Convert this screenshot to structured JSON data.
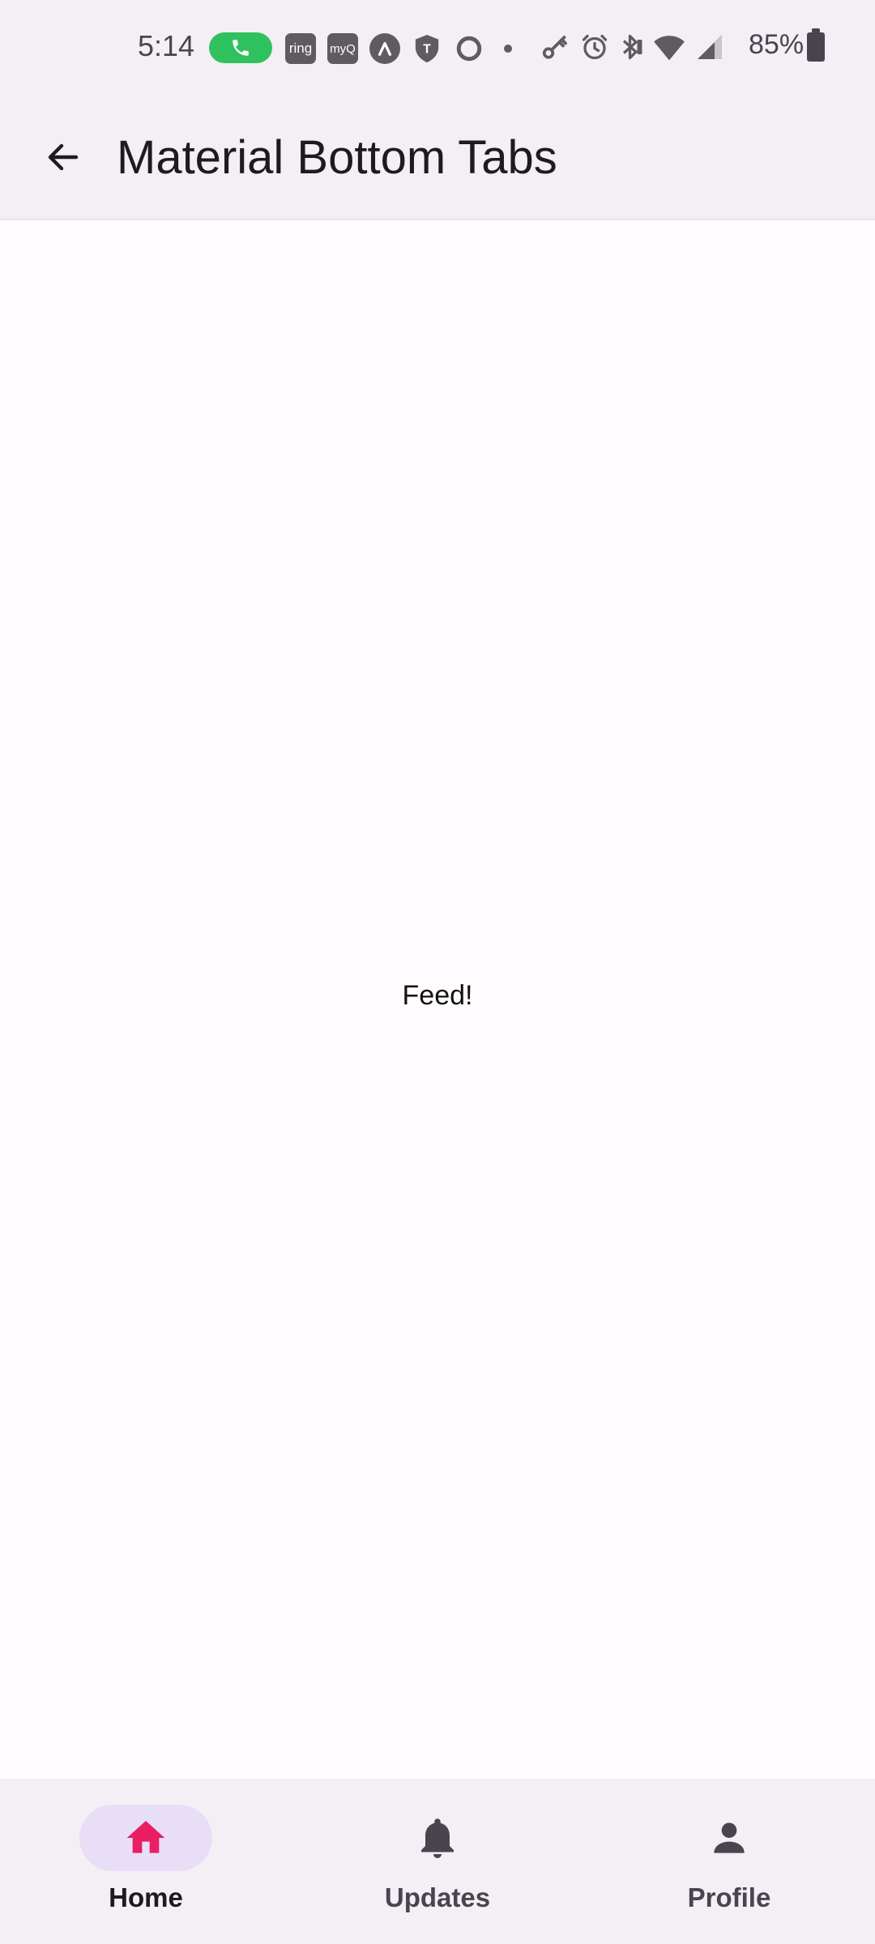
{
  "status_bar": {
    "time": "5:14",
    "battery": "85%",
    "notification_icons": [
      "call-active-icon",
      "ring-icon",
      "myq-icon",
      "arc-icon",
      "tmobile-shield-icon",
      "circle-app-icon",
      "dot-icon"
    ],
    "system_icons": [
      "vpn-key-icon",
      "alarm-icon",
      "bluetooth-icon",
      "wifi-icon",
      "cellular-signal-icon",
      "battery-icon"
    ],
    "ring_label": "ring",
    "myq_label": "myQ",
    "call_color": "#2fc15d"
  },
  "app_bar": {
    "title": "Material Bottom Tabs",
    "back_icon": "arrow-back-icon"
  },
  "content": {
    "text": "Feed!"
  },
  "bottom_nav": {
    "active_indicator_color": "#e8def8",
    "active_icon_color": "#e91e63",
    "items": [
      {
        "label": "Home",
        "icon": "home-icon",
        "active": true
      },
      {
        "label": "Updates",
        "icon": "bell-icon",
        "active": false
      },
      {
        "label": "Profile",
        "icon": "person-icon",
        "active": false
      }
    ]
  }
}
